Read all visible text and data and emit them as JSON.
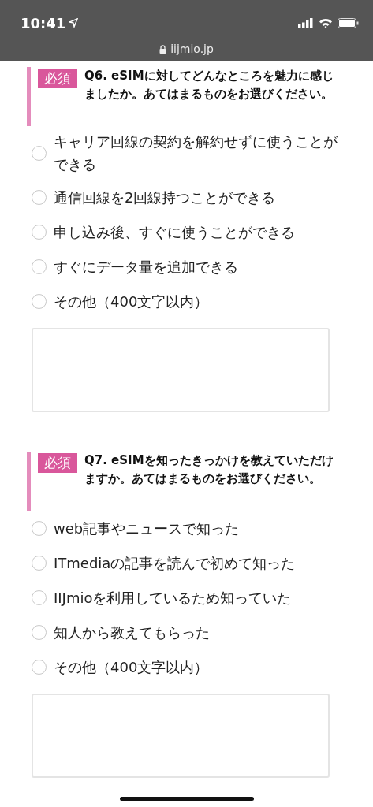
{
  "status_bar": {
    "time": "10:41",
    "url": "iijmio.jp"
  },
  "questions": [
    {
      "badge": "必須",
      "text": "Q6. eSIMに対してどんなところを魅力に感じましたか。あてはまるものをお選びください。",
      "options": [
        {
          "label": "キャリア回線の契約を解約せずに使うことができる",
          "selected": false
        },
        {
          "label": "通信回線を2回線持つことができる",
          "selected": false
        },
        {
          "label": "申し込み後、すぐに使うことができる",
          "selected": false
        },
        {
          "label": "すぐにデータ量を追加できる",
          "selected": false
        },
        {
          "label": "その他（400文字以内）",
          "selected": false
        }
      ]
    },
    {
      "badge": "必須",
      "text": "Q7. eSIMを知ったきっかけを教えていただけますか。あてはまるものをお選びください。",
      "options": [
        {
          "label": "web記事やニュースで知った",
          "selected": false
        },
        {
          "label": "ITmediaの記事を読んで初めて知った",
          "selected": false
        },
        {
          "label": "IIJmioを利用しているため知っていた",
          "selected": false
        },
        {
          "label": "知人から教えてもらった",
          "selected": false
        },
        {
          "label": "その他（400文字以内）",
          "selected": false
        }
      ]
    }
  ]
}
